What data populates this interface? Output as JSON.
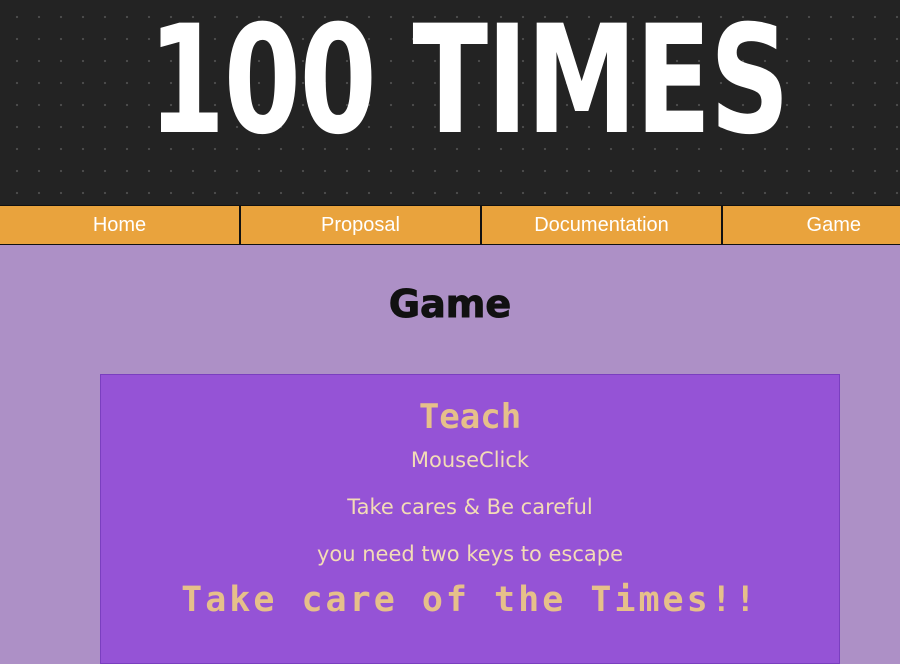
{
  "banner": {
    "title": "100 TIMES"
  },
  "nav": {
    "items": [
      {
        "label": "Home"
      },
      {
        "label": "Proposal"
      },
      {
        "label": "Documentation"
      },
      {
        "label": "Game"
      }
    ]
  },
  "main": {
    "title": "Game",
    "panel": {
      "heading": "Teach",
      "lines": [
        "MouseClick",
        "Take cares & Be careful",
        "you need two keys to escape"
      ],
      "warning": "Take care of the Times!!"
    }
  },
  "colors": {
    "banner_bg": "#232323",
    "nav_bg": "#e9a33d",
    "page_bg": "#ad90c6",
    "panel_bg": "#9553d6",
    "panel_text": "#e6c08a"
  }
}
